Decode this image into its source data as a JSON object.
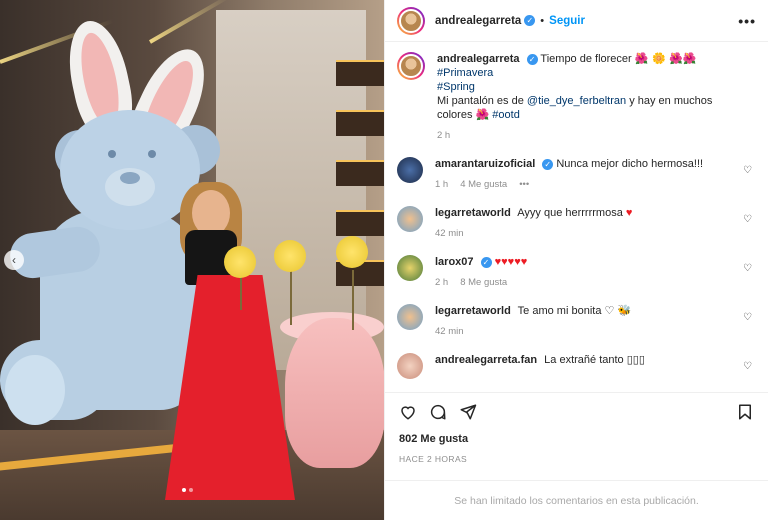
{
  "post": {
    "author": "andrealegarreta",
    "follow_label": "Seguir",
    "bullet": "•",
    "more_label": "•••"
  },
  "caption": {
    "username": "andrealegarreta",
    "text_1": "Tiempo de florecer",
    "emojis_1": "🌺 🌼 🌺🌺",
    "hashtag_1": "#Primavera",
    "hashtag_2": "#Spring",
    "text_2a": "Mi pantalón es de",
    "mention": "@tie_dye_ferbeltran",
    "text_2b": "y hay en muchos colores",
    "emoji_2": "🌺",
    "hashtag_3": "#ootd",
    "time": "2 h"
  },
  "comments": [
    {
      "username": "amarantaruizoficial",
      "verified": true,
      "text": "Nunca mejor dicho hermosa!!!",
      "time": "1 h",
      "likes": "4 Me gusta",
      "more": "•••"
    },
    {
      "username": "legarretaworld",
      "verified": false,
      "text": "Ayyy que herrrrrmosa",
      "emoji": "♥",
      "time": "42 min"
    },
    {
      "username": "larox07",
      "verified": true,
      "text": "",
      "emoji": "♥♥♥♥♥",
      "time": "2 h",
      "likes": "8 Me gusta"
    },
    {
      "username": "legarretaworld",
      "verified": false,
      "text": "Te amo mi bonita",
      "emoji": "♡ 🐝",
      "time": "42 min"
    },
    {
      "username": "andrealegarreta.fan",
      "verified": false,
      "text": "La extrañé tanto",
      "emoji": "▯▯▯",
      "time": ""
    }
  ],
  "engagement": {
    "likes": "802 Me gusta",
    "time": "HACE 2 HORAS",
    "limited_notice": "Se han limitado los comentarios en esta publicación."
  },
  "icons": {
    "like": "heart-icon",
    "comment": "comment-icon",
    "share": "share-icon",
    "save": "bookmark-icon"
  },
  "colors": {
    "link": "#0095f6",
    "verified": "#3897f0",
    "hashtag": "#00376b",
    "heart": "#ed1c24"
  }
}
